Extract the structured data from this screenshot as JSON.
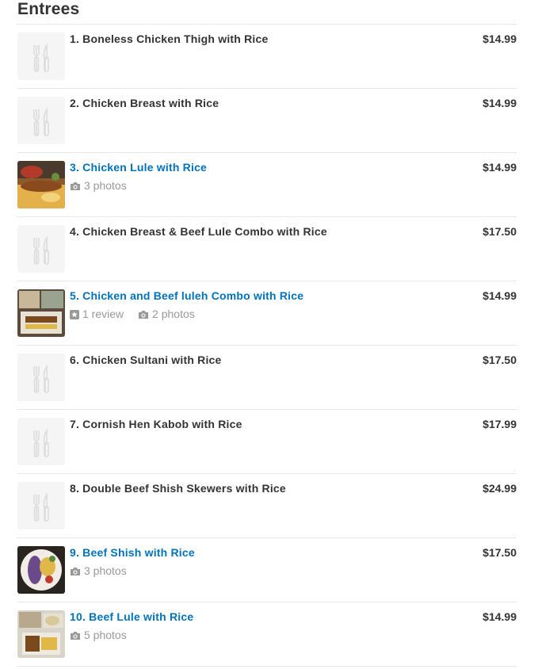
{
  "section": {
    "title": "Entrees"
  },
  "items": [
    {
      "name": "1. Boneless Chicken Thigh with Rice",
      "price": "$14.99",
      "linked": false,
      "photo": false
    },
    {
      "name": "2. Chicken Breast with Rice",
      "price": "$14.99",
      "linked": false,
      "photo": false
    },
    {
      "name": "3. Chicken Lule with Rice",
      "price": "$14.99",
      "linked": true,
      "photo": true,
      "photos": "3 photos"
    },
    {
      "name": "4. Chicken Breast & Beef Lule Combo with Rice",
      "price": "$17.50",
      "linked": false,
      "photo": false
    },
    {
      "name": "5. Chicken and Beef luleh Combo with Rice",
      "price": "$14.99",
      "linked": true,
      "photo": true,
      "reviews": "1 review",
      "photos": "2 photos"
    },
    {
      "name": "6. Chicken Sultani with Rice",
      "price": "$17.50",
      "linked": false,
      "photo": false
    },
    {
      "name": "7. Cornish Hen Kabob with Rice",
      "price": "$17.99",
      "linked": false,
      "photo": false
    },
    {
      "name": "8. Double Beef Shish Skewers with Rice",
      "price": "$24.99",
      "linked": false,
      "photo": false
    },
    {
      "name": "9. Beef Shish with Rice",
      "price": "$17.50",
      "linked": true,
      "photo": true,
      "photos": "3 photos"
    },
    {
      "name": "10. Beef Lule with Rice",
      "price": "$14.99",
      "linked": true,
      "photo": true,
      "photos": "5 photos"
    }
  ],
  "icons": {
    "placeholder": "fork-knife-icon",
    "photos": "camera-icon",
    "reviews": "star-square-icon"
  },
  "colors": {
    "link": "#0073bb",
    "text": "#333333",
    "meta": "#999999",
    "divider": "#e6e6e6",
    "placeholder_bg": "#f5f5f5"
  }
}
